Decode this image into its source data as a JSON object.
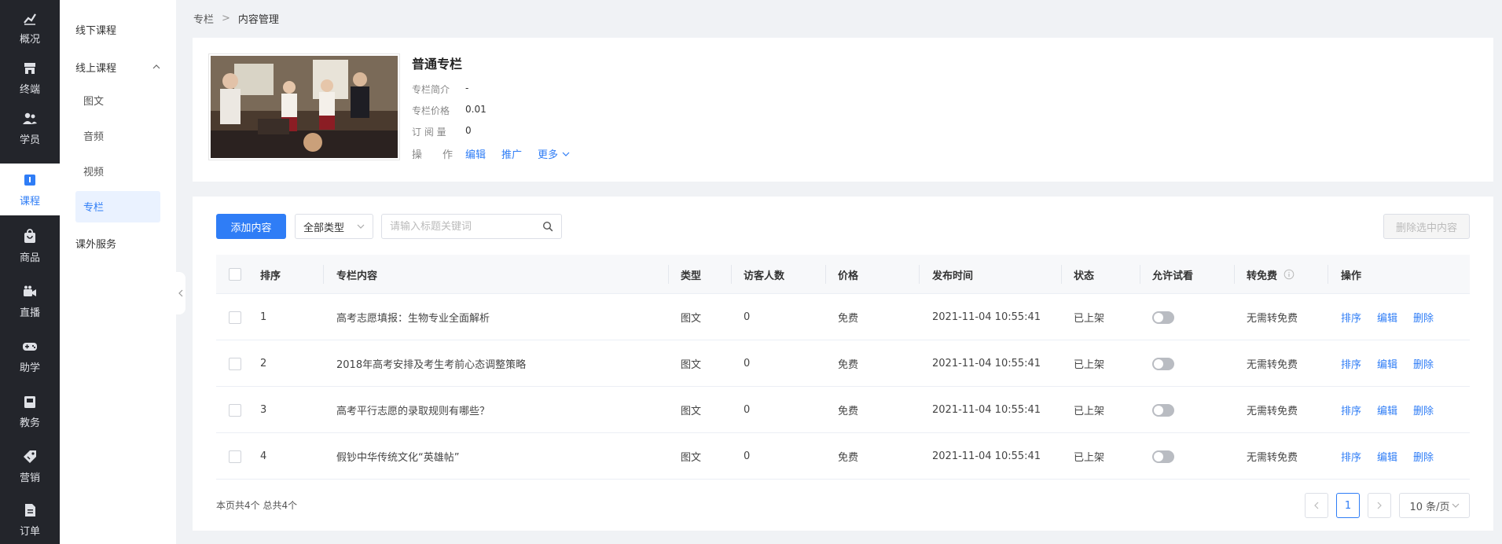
{
  "rail": {
    "items": [
      {
        "label": "概况",
        "icon": "chart-icon"
      },
      {
        "label": "终端",
        "icon": "store-icon"
      },
      {
        "label": "学员",
        "icon": "users-icon"
      },
      {
        "label": "课程",
        "icon": "book-icon",
        "active": true
      },
      {
        "label": "商品",
        "icon": "bag-icon"
      },
      {
        "label": "直播",
        "icon": "video-camera-icon"
      },
      {
        "label": "助学",
        "icon": "gamepad-icon"
      },
      {
        "label": "教务",
        "icon": "clipboard-icon"
      },
      {
        "label": "营销",
        "icon": "tag-icon"
      },
      {
        "label": "订单",
        "icon": "document-icon"
      }
    ]
  },
  "submenu": {
    "offline": "线下课程",
    "online": "线上课程",
    "online_children": [
      "图文",
      "音频",
      "视频",
      "专栏"
    ],
    "extra": "课外服务"
  },
  "breadcrumb": {
    "parent": "专栏",
    "separator": ">",
    "current": "内容管理"
  },
  "column": {
    "title": "普通专栏",
    "intro_label": "专栏简介",
    "intro_value": "-",
    "price_label": "专栏价格",
    "price_value": "0.01",
    "subs_label": "订 阅 量",
    "subs_value": "0",
    "ops_label": "操　　作",
    "op_edit": "编辑",
    "op_promote": "推广",
    "op_more": "更多"
  },
  "toolbar": {
    "add_label": "添加内容",
    "type_select": "全部类型",
    "search_placeholder": "请输入标题关键词",
    "delete_selected": "删除选中内容"
  },
  "table": {
    "headers": {
      "order": "排序",
      "content": "专栏内容",
      "type": "类型",
      "visitors": "访客人数",
      "price": "价格",
      "publish_time": "发布时间",
      "status": "状态",
      "trial": "允许试看",
      "free": "转免费",
      "actions": "操作"
    },
    "rows": [
      {
        "order": "1",
        "title": "高考志愿填报：生物专业全面解析",
        "type": "图文",
        "visitors": "0",
        "price": "免费",
        "time": "2021-11-04 10:55:41",
        "status": "已上架",
        "trial": false,
        "free": "无需转免费"
      },
      {
        "order": "2",
        "title": "2018年高考安排及考生考前心态调整策略",
        "type": "图文",
        "visitors": "0",
        "price": "免费",
        "time": "2021-11-04 10:55:41",
        "status": "已上架",
        "trial": false,
        "free": "无需转免费"
      },
      {
        "order": "3",
        "title": "高考平行志愿的录取规则有哪些？",
        "type": "图文",
        "visitors": "0",
        "price": "免费",
        "time": "2021-11-04 10:55:41",
        "status": "已上架",
        "trial": false,
        "free": "无需转免费"
      },
      {
        "order": "4",
        "title": "假钞中华传统文化“英雄帖”",
        "type": "图文",
        "visitors": "0",
        "price": "免费",
        "time": "2021-11-04 10:55:41",
        "status": "已上架",
        "trial": false,
        "free": "无需转免费"
      }
    ],
    "row_actions": {
      "sort": "排序",
      "edit": "编辑",
      "delete": "删除"
    }
  },
  "footer": {
    "summary": "本页共4个 总共4个",
    "current_page": "1",
    "page_size": "10 条/页"
  },
  "colors": {
    "accent": "#2f7df6",
    "rail_bg": "#23252b"
  }
}
